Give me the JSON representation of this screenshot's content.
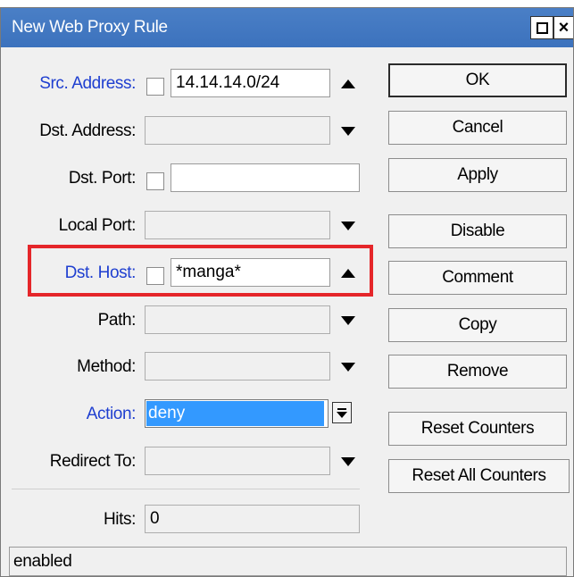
{
  "window": {
    "title": "New Web Proxy Rule"
  },
  "fields": {
    "src_address": {
      "label": "Src. Address:",
      "value": "14.14.14.0/24"
    },
    "dst_address": {
      "label": "Dst. Address:",
      "value": ""
    },
    "dst_port": {
      "label": "Dst. Port:",
      "value": ""
    },
    "local_port": {
      "label": "Local Port:",
      "value": ""
    },
    "dst_host": {
      "label": "Dst. Host:",
      "value": "*manga*"
    },
    "path": {
      "label": "Path:",
      "value": ""
    },
    "method": {
      "label": "Method:",
      "value": ""
    },
    "action": {
      "label": "Action:",
      "value": "deny"
    },
    "redirect_to": {
      "label": "Redirect To:",
      "value": ""
    },
    "hits": {
      "label": "Hits:",
      "value": "0"
    }
  },
  "buttons": {
    "ok": "OK",
    "cancel": "Cancel",
    "apply": "Apply",
    "disable": "Disable",
    "comment": "Comment",
    "copy": "Copy",
    "remove": "Remove",
    "reset_counters": "Reset Counters",
    "reset_all_counters": "Reset All Counters"
  },
  "status": "enabled",
  "colors": {
    "titlebar": "#3c72bd",
    "label_highlight": "#1f3fd0",
    "selection": "#3399ff",
    "highlight_box": "#e5262a"
  }
}
